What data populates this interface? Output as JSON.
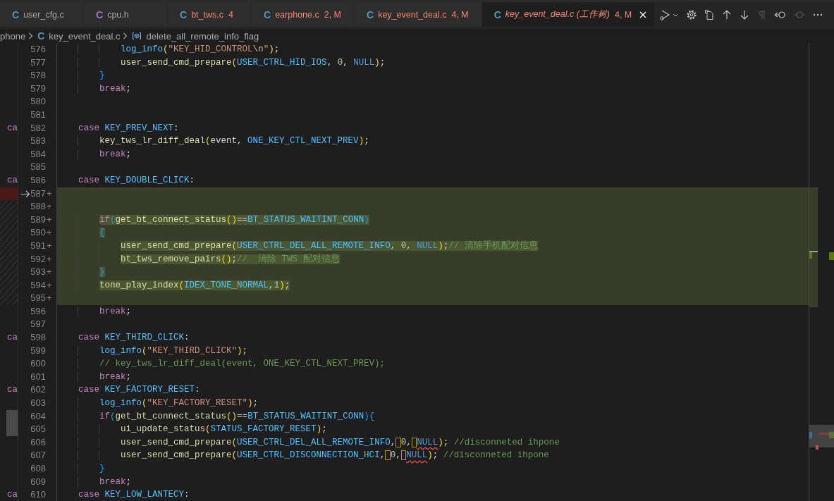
{
  "tabs": [
    {
      "icon": "C",
      "color": "#519aba",
      "label": "user_cfg.c",
      "error": false,
      "selected": false,
      "preview": false
    },
    {
      "icon": "C",
      "color": "#a074c4",
      "label": "cpu.h",
      "error": false,
      "selected": false,
      "preview": false
    },
    {
      "icon": "C",
      "color": "#519aba",
      "label": "bt_tws.c",
      "badge": "4",
      "error": true,
      "selected": false,
      "preview": false
    },
    {
      "icon": "C",
      "color": "#519aba",
      "label": "earphone.c",
      "badge": "2, M",
      "error": true,
      "selected": false,
      "preview": false
    },
    {
      "icon": "C",
      "color": "#519aba",
      "label": "key_event_deal.c",
      "badge": "4, M",
      "error": true,
      "selected": false,
      "preview": false
    },
    {
      "icon": "C",
      "color": "#519aba",
      "label": "key_event_deal.c (工作树)",
      "badge": "4, M",
      "error": true,
      "selected": true,
      "preview": true
    }
  ],
  "toolbar": [
    {
      "kind": "run-debug",
      "disabled": false
    },
    {
      "kind": "settings",
      "disabled": false
    },
    {
      "kind": "open-file",
      "disabled": false
    },
    {
      "kind": "previous",
      "disabled": false
    },
    {
      "kind": "next",
      "disabled": false
    },
    {
      "kind": "whitespace",
      "disabled": true
    },
    {
      "kind": "prev-change",
      "disabled": false
    },
    {
      "kind": "next-change",
      "disabled": true
    },
    {
      "kind": "more",
      "disabled": false
    }
  ],
  "breadcrumb": [
    {
      "kind": "folder",
      "label": "phone"
    },
    {
      "kind": "file",
      "icon": "C",
      "label": "key_event_deal.c"
    },
    {
      "kind": "symbol",
      "label": "delete_all_remote_info_flag"
    }
  ],
  "lines": [
    {
      "n": "576",
      "added": false,
      "arrow": false,
      "tokens": [
        {
          "text": "            log_info",
          "kind": "mac"
        },
        {
          "text": "(",
          "kind": "b1"
        },
        {
          "text": "\"KEY_HID_CONTROL",
          "kind": "str"
        },
        {
          "text": "\\n",
          "kind": "esc"
        },
        {
          "text": "\"",
          "kind": "str"
        },
        {
          "text": ")",
          "kind": "b1"
        },
        {
          "text": ";",
          "kind": "p"
        }
      ]
    },
    {
      "n": "577",
      "added": false,
      "arrow": false,
      "tokens": [
        {
          "text": "            user_send_cmd_prepare",
          "kind": "fn"
        },
        {
          "text": "(",
          "kind": "b1"
        },
        {
          "text": "USER_CTRL_HID_IOS",
          "kind": "mac"
        },
        {
          "text": ", ",
          "kind": "p"
        },
        {
          "text": "0",
          "kind": "num"
        },
        {
          "text": ", ",
          "kind": "p"
        },
        {
          "text": "NULL",
          "kind": "nul"
        },
        {
          "text": ")",
          "kind": "b1"
        },
        {
          "text": ";",
          "kind": "p"
        }
      ]
    },
    {
      "n": "578",
      "added": false,
      "arrow": false,
      "tokens": [
        {
          "text": "        }",
          "kind": "b3"
        }
      ]
    },
    {
      "n": "579",
      "added": false,
      "arrow": false,
      "tokens": [
        {
          "text": "        break",
          "kind": "kw"
        },
        {
          "text": ";",
          "kind": "p"
        }
      ]
    },
    {
      "n": "580",
      "added": false,
      "arrow": false
    },
    {
      "n": "581",
      "added": false,
      "arrow": false
    },
    {
      "n": "582",
      "added": false,
      "arrow": false,
      "left": {
        "kind": "text",
        "text": "ca"
      },
      "tokens": [
        {
          "text": "    case",
          "kind": "kw"
        },
        {
          "text": " KEY_PREV_NEXT",
          "kind": "mac"
        },
        {
          "text": ":",
          "kind": "p"
        }
      ]
    },
    {
      "n": "583",
      "added": false,
      "arrow": false,
      "tokens": [
        {
          "text": "        key_tws_lr_diff_deal",
          "kind": "fn"
        },
        {
          "text": "(",
          "kind": "b1"
        },
        {
          "text": "event, ",
          "kind": "p"
        },
        {
          "text": "ONE_KEY_CTL_NEXT_PREV",
          "kind": "mac"
        },
        {
          "text": ")",
          "kind": "b1"
        },
        {
          "text": ";",
          "kind": "p"
        }
      ]
    },
    {
      "n": "584",
      "added": false,
      "arrow": false,
      "tokens": [
        {
          "text": "        break",
          "kind": "kw"
        },
        {
          "text": ";",
          "kind": "p"
        }
      ]
    },
    {
      "n": "585",
      "added": false,
      "arrow": false
    },
    {
      "n": "586",
      "added": false,
      "arrow": false,
      "left": {
        "kind": "text",
        "text": "ca"
      },
      "tokens": [
        {
          "text": "    case",
          "kind": "kw"
        },
        {
          "text": " KEY_DOUBLE_CLICK",
          "kind": "mac"
        },
        {
          "text": ":",
          "kind": "p"
        }
      ]
    },
    {
      "n": "587",
      "plus": "+",
      "added": true,
      "arrow": true,
      "left": {
        "kind": "removed"
      }
    },
    {
      "n": "588",
      "plus": "+",
      "added": true,
      "arrow": false,
      "left": {
        "kind": "hatch"
      }
    },
    {
      "n": "589",
      "plus": "+",
      "added": true,
      "arrow": false,
      "left": {
        "kind": "hatch"
      },
      "tokens": [
        {
          "text": "        if",
          "kind": "kw"
        },
        {
          "text": "(",
          "kind": "b3"
        },
        {
          "text": "get_bt_connect_status",
          "kind": "fn"
        },
        {
          "text": "()",
          "kind": "b1"
        },
        {
          "text": "==",
          "kind": "p"
        },
        {
          "text": "BT_STATUS_WAITINT_CONN",
          "kind": "mac"
        },
        {
          "text": ")",
          "kind": "b3"
        }
      ]
    },
    {
      "n": "590",
      "plus": "+",
      "added": true,
      "arrow": false,
      "left": {
        "kind": "hatch"
      },
      "tokens": [
        {
          "text": "        {",
          "kind": "b3"
        }
      ]
    },
    {
      "n": "591",
      "plus": "+",
      "added": true,
      "arrow": false,
      "left": {
        "kind": "hatch"
      },
      "tokens": [
        {
          "text": "            user_send_cmd_prepare",
          "kind": "fn"
        },
        {
          "text": "(",
          "kind": "b1"
        },
        {
          "text": "USER_CTRL_DEL_ALL_REMOTE_INFO",
          "kind": "mac"
        },
        {
          "text": ", ",
          "kind": "p"
        },
        {
          "text": "0",
          "kind": "num"
        },
        {
          "text": ", ",
          "kind": "p"
        },
        {
          "text": "NULL",
          "kind": "nul"
        },
        {
          "text": ")",
          "kind": "b1"
        },
        {
          "text": ";",
          "kind": "p"
        },
        {
          "text": "// 清除手机配对信息",
          "kind": "com"
        }
      ]
    },
    {
      "n": "592",
      "plus": "+",
      "added": true,
      "arrow": false,
      "left": {
        "kind": "hatch"
      },
      "tokens": [
        {
          "text": "            bt_tws_remove_pairs",
          "kind": "fn"
        },
        {
          "text": "()",
          "kind": "b1"
        },
        {
          "text": ";",
          "kind": "p"
        },
        {
          "text": "//  清除 TWS 配对信息",
          "kind": "com"
        }
      ]
    },
    {
      "n": "593",
      "plus": "+",
      "added": true,
      "arrow": false,
      "left": {
        "kind": "hatch"
      },
      "tokens": [
        {
          "text": "        }",
          "kind": "b3"
        }
      ]
    },
    {
      "n": "594",
      "plus": "+",
      "added": true,
      "arrow": false,
      "left": {
        "kind": "hatch"
      },
      "tokens": [
        {
          "text": "        tone_play_index",
          "kind": "fn"
        },
        {
          "text": "(",
          "kind": "b1"
        },
        {
          "text": "IDEX_TONE_NORMAL",
          "kind": "mac"
        },
        {
          "text": ",",
          "kind": "p"
        },
        {
          "text": "1",
          "kind": "num"
        },
        {
          "text": ")",
          "kind": "b1"
        },
        {
          "text": ";",
          "kind": "p"
        }
      ]
    },
    {
      "n": "595",
      "plus": "+",
      "added": true,
      "arrow": false,
      "left": {
        "kind": "hatch"
      }
    },
    {
      "n": "596",
      "added": false,
      "arrow": false,
      "tokens": [
        {
          "text": "        break",
          "kind": "kw"
        },
        {
          "text": ";",
          "kind": "p"
        }
      ]
    },
    {
      "n": "597",
      "added": false,
      "arrow": false
    },
    {
      "n": "598",
      "added": false,
      "arrow": false,
      "left": {
        "kind": "text",
        "text": "ca"
      },
      "tokens": [
        {
          "text": "    case",
          "kind": "kw"
        },
        {
          "text": " KEY_THIRD_CLICK",
          "kind": "mac"
        },
        {
          "text": ":",
          "kind": "p"
        }
      ]
    },
    {
      "n": "599",
      "added": false,
      "arrow": false,
      "tokens": [
        {
          "text": "        log_info",
          "kind": "mac"
        },
        {
          "text": "(",
          "kind": "b1"
        },
        {
          "text": "\"KEY_THIRD_CLICK\"",
          "kind": "str"
        },
        {
          "text": ")",
          "kind": "b1"
        },
        {
          "text": ";",
          "kind": "p"
        }
      ]
    },
    {
      "n": "600",
      "added": false,
      "arrow": false,
      "tokens": [
        {
          "text": "        // key_tws_lr_diff_deal(event, ONE_KEY_CTL_NEXT_PREV);",
          "kind": "com"
        }
      ]
    },
    {
      "n": "601",
      "added": false,
      "arrow": false,
      "tokens": [
        {
          "text": "        break",
          "kind": "kw"
        },
        {
          "text": ";",
          "kind": "p"
        }
      ]
    },
    {
      "n": "602",
      "added": false,
      "arrow": false,
      "left": {
        "kind": "text",
        "text": "ca"
      },
      "tokens": [
        {
          "text": "    case",
          "kind": "kw"
        },
        {
          "text": " KEY_FACTORY_RESET",
          "kind": "mac"
        },
        {
          "text": ":",
          "kind": "p"
        }
      ]
    },
    {
      "n": "603",
      "added": false,
      "arrow": false,
      "tokens": [
        {
          "text": "        log_info",
          "kind": "mac"
        },
        {
          "text": "(",
          "kind": "b1"
        },
        {
          "text": "\"KEY_FACTORY_RESET\"",
          "kind": "str"
        },
        {
          "text": ")",
          "kind": "b1"
        },
        {
          "text": ";",
          "kind": "p"
        }
      ]
    },
    {
      "n": "604",
      "added": false,
      "arrow": false,
      "left": {
        "kind": "slider"
      },
      "tokens": [
        {
          "text": "        if",
          "kind": "kw"
        },
        {
          "text": "(",
          "kind": "b3"
        },
        {
          "text": "get_bt_connect_status",
          "kind": "fn"
        },
        {
          "text": "()",
          "kind": "b1"
        },
        {
          "text": "==",
          "kind": "p"
        },
        {
          "text": "BT_STATUS_WAITINT_CONN",
          "kind": "mac"
        },
        {
          "text": "){",
          "kind": "b3"
        }
      ]
    },
    {
      "n": "605",
      "added": false,
      "arrow": false,
      "left": {
        "kind": "slider"
      },
      "tokens": [
        {
          "text": "            ui_update_status",
          "kind": "fn"
        },
        {
          "text": "(",
          "kind": "b1"
        },
        {
          "text": "STATUS_FACTORY_RESET",
          "kind": "mac"
        },
        {
          "text": ")",
          "kind": "b1"
        },
        {
          "text": ";",
          "kind": "p"
        }
      ]
    },
    {
      "n": "606",
      "added": false,
      "arrow": false,
      "tokens": [
        {
          "text": "            user_send_cmd_prepare",
          "kind": "fn"
        },
        {
          "text": "(",
          "kind": "b1"
        },
        {
          "text": "USER_CTRL_DEL_ALL_REMOTE_INFO",
          "kind": "mac"
        },
        {
          "text": ",",
          "kind": "p"
        },
        {
          "text": " 0",
          "kind": "num-warn"
        },
        {
          "text": ",",
          "kind": "p"
        },
        {
          "text": " NULL",
          "kind": "nul-err"
        },
        {
          "text": ")",
          "kind": "b1"
        },
        {
          "text": "; ",
          "kind": "p"
        },
        {
          "text": "//disconneted ihpone",
          "kind": "com"
        }
      ]
    },
    {
      "n": "607",
      "added": false,
      "arrow": false,
      "tokens": [
        {
          "text": "            user_send_cmd_prepare",
          "kind": "fn"
        },
        {
          "text": "(",
          "kind": "b1"
        },
        {
          "text": "USER_CTRL_DISCONNECTION_HCI",
          "kind": "mac"
        },
        {
          "text": ",",
          "kind": "p"
        },
        {
          "text": " 0",
          "kind": "num-warn"
        },
        {
          "text": ",",
          "kind": "p"
        },
        {
          "text": " NULL",
          "kind": "nul-err"
        },
        {
          "text": ")",
          "kind": "b1"
        },
        {
          "text": "; ",
          "kind": "p"
        },
        {
          "text": "//disconneted ihpone",
          "kind": "com"
        }
      ]
    },
    {
      "n": "608",
      "added": false,
      "arrow": false,
      "tokens": [
        {
          "text": "        }",
          "kind": "b3"
        }
      ]
    },
    {
      "n": "609",
      "added": false,
      "arrow": false,
      "tokens": [
        {
          "text": "        break",
          "kind": "kw"
        },
        {
          "text": ";",
          "kind": "p"
        }
      ]
    },
    {
      "n": "610",
      "added": false,
      "arrow": false,
      "left": {
        "kind": "text",
        "text": "ca"
      },
      "tokens": [
        {
          "text": "    case",
          "kind": "kw"
        },
        {
          "text": " KEY_LOW_LANTECY",
          "kind": "mac"
        },
        {
          "text": ":",
          "kind": "p"
        }
      ]
    }
  ]
}
